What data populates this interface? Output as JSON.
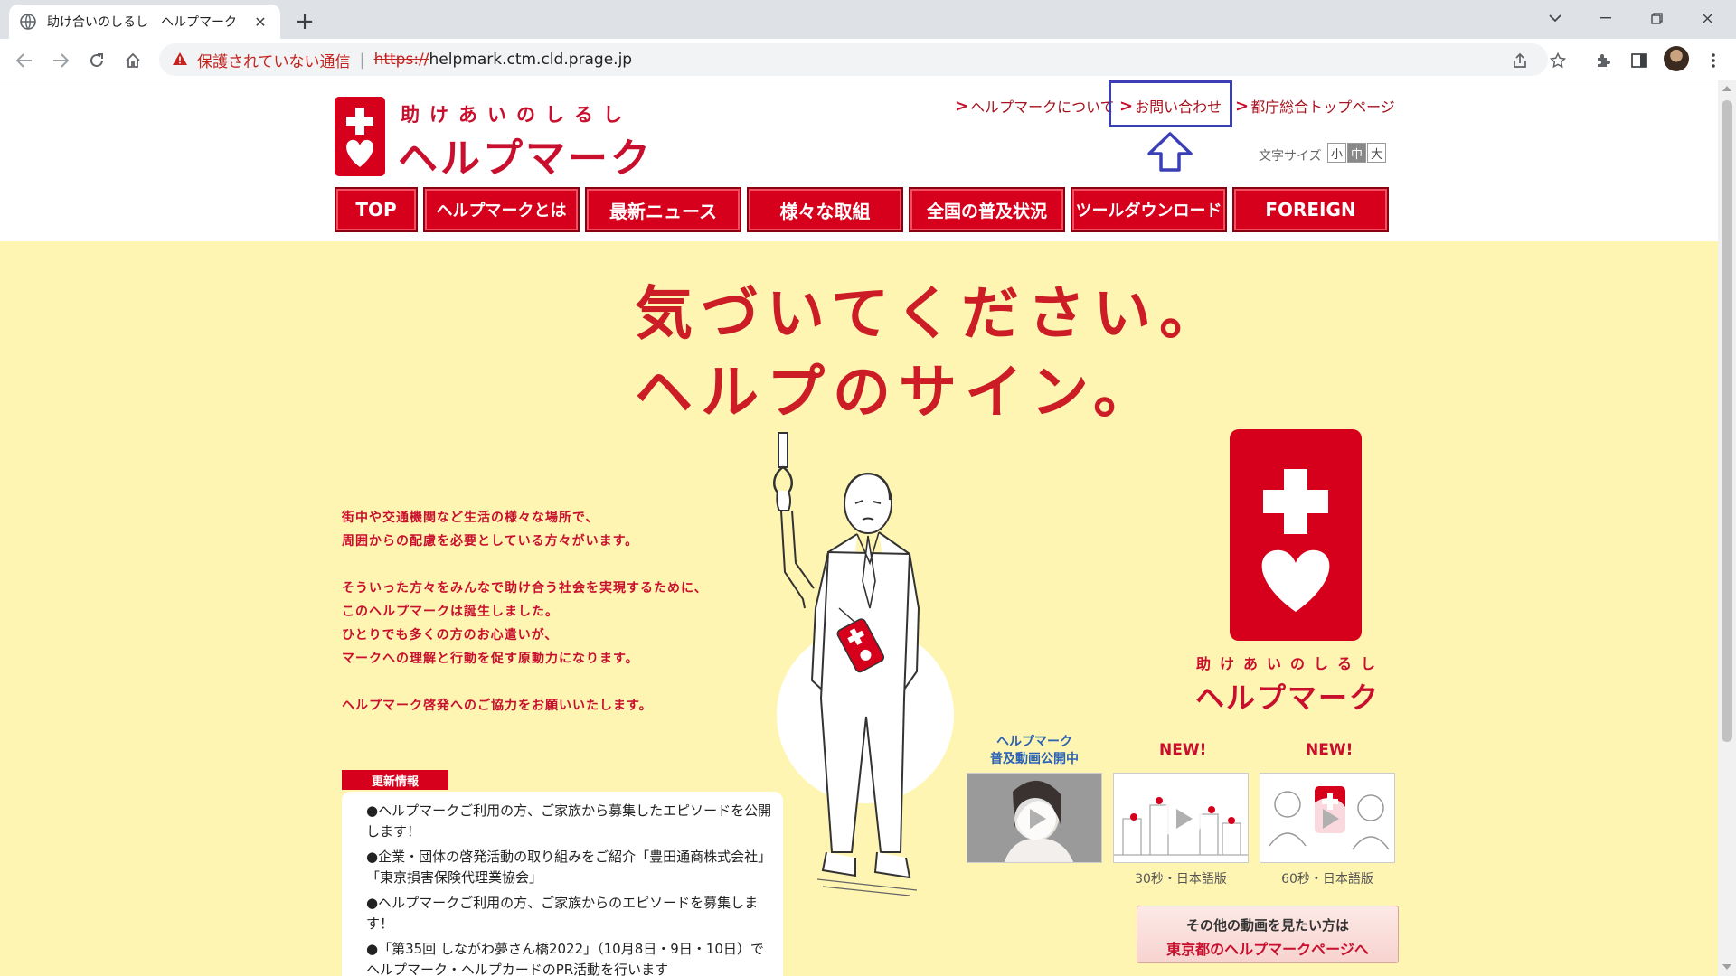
{
  "browser": {
    "tab_title": "助け合いのしるし　ヘルプマーク",
    "security_text": "保護されていない通信",
    "url_scheme": "https://",
    "url_host": "helpmark.ctm.cld.prage.jp"
  },
  "header": {
    "tagline": "助けあいのしるし",
    "logo_name": "ヘルプマーク",
    "links": [
      "ヘルプマークについて",
      "お問い合わせ",
      "都庁総合トップページ"
    ],
    "font_size_label": "文字サイズ",
    "font_sizes": [
      "小",
      "中",
      "大"
    ]
  },
  "nav": [
    "TOP",
    "ヘルプマークとは",
    "最新ニュース",
    "様々な取組",
    "全国の普及状況",
    "ツールダウンロード",
    "FOREIGN"
  ],
  "hero": {
    "headline_1": "気づいてください。",
    "headline_2": "ヘルプのサイン。",
    "intro": [
      "街中や交通機関など生活の様々な場所で、",
      "周囲からの配慮を必要としている方々がいます。",
      "そういった方々をみんなで助け合う社会を実現するために、",
      "このヘルプマークは誕生しました。",
      "ひとりでも多くの方のお心遣いが、",
      "マークへの理解と行動を促す原動力になります。",
      "ヘルプマーク啓発へのご協力をお願いいたします。"
    ],
    "mark_tagline": "助けあいのしるし",
    "mark_name": "ヘルプマーク"
  },
  "news": {
    "label": "更新情報",
    "items": [
      "●ヘルプマークご利用の方、ご家族から募集したエピソードを公開します！",
      "●企業・団体の啓発活動の取り組みをご紹介「豊田通商株式会社」「東京損害保険代理業協会」",
      "●ヘルプマークご利用の方、ご家族からのエピソードを募集します！",
      "●「第35回 しながわ夢さん橋2022」（10月8日・9日・10日）でヘルプマーク・ヘルプカードのPR活動を行います"
    ]
  },
  "videos": {
    "caption_1": "ヘルプマーク",
    "caption_2": "普及動画公開中",
    "new_label": "NEW!",
    "dur_30": "30秒・日本語版",
    "dur_60": "60秒・日本語版",
    "more_1": "その他の動画を見たい方は",
    "more_2": "東京都のヘルプマークページへ"
  }
}
